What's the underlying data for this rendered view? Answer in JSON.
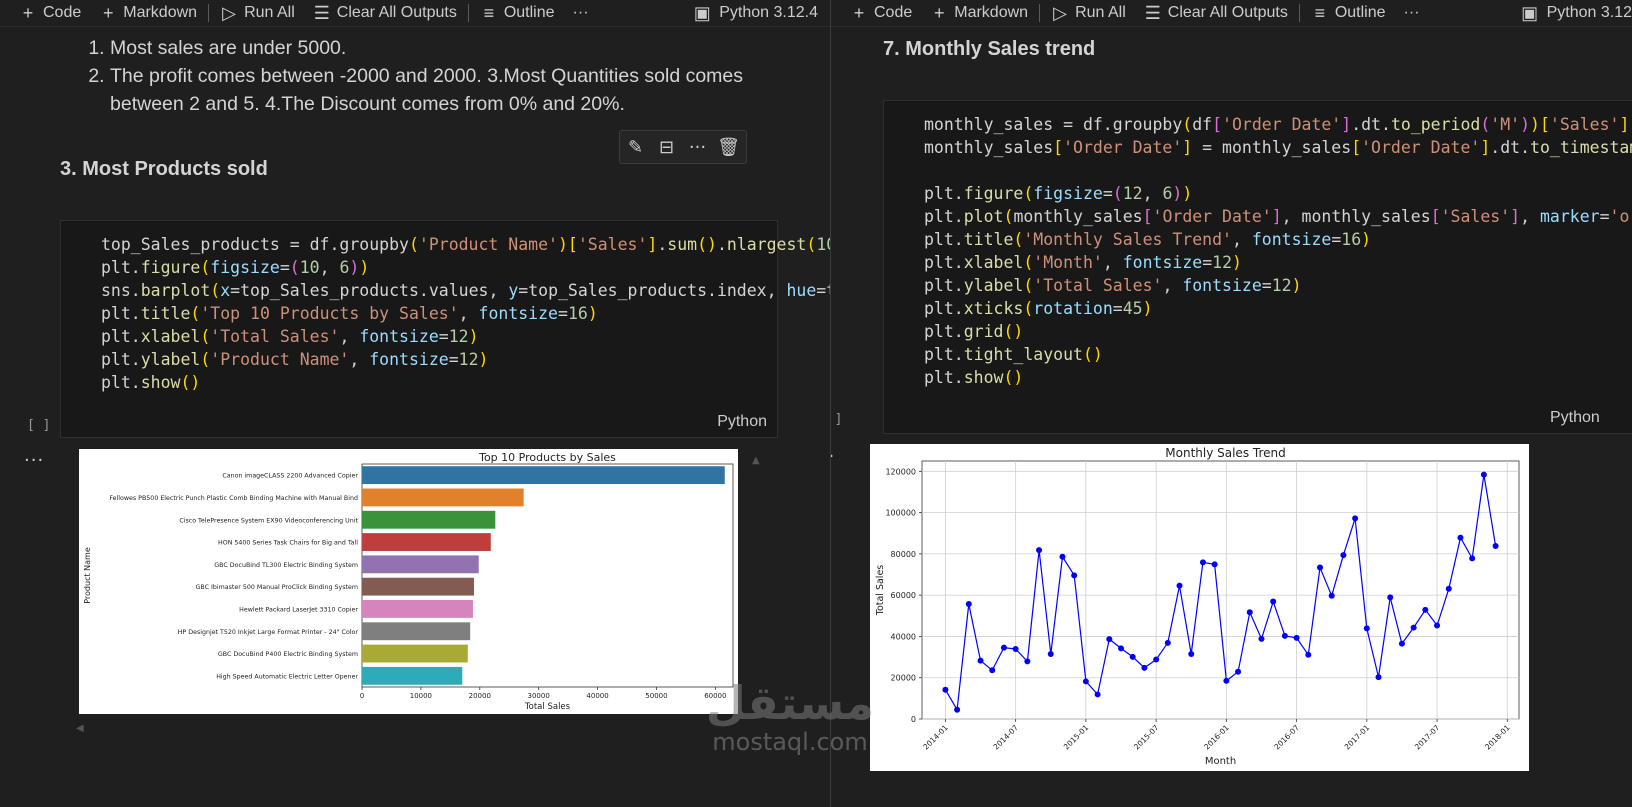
{
  "toolbar": {
    "code": "Code",
    "markdown": "Markdown",
    "run_all": "Run All",
    "clear_all_outputs": "Clear All Outputs",
    "outline": "Outline",
    "more": "···",
    "kernel": "Python 3.12.4",
    "kernel_right": "Python 3.12"
  },
  "left": {
    "markdown_list": [
      "Most sales are under 5000.",
      "The profit comes between -2000 and 2000. 3.Most Quantities sold comes between 2 and 5. 4.The Discount comes from 0% and 20%."
    ],
    "heading": "3. Most Products sold",
    "cell_language": "Python",
    "exec_count": "[ ]",
    "output_more": "···"
  },
  "right": {
    "heading": "7. Monthly Sales trend",
    "cell_language": "Python",
    "exec_count": "[ ]",
    "output_more": "···"
  },
  "icons": {
    "add": "plus-icon",
    "run": "run-all-icon",
    "clear": "clear-outputs-icon",
    "outline": "outline-icon",
    "kernel": "kernel-icon",
    "edit": "pencil-icon",
    "split": "split-cell-icon",
    "delete": "trash-icon"
  },
  "watermark": {
    "arabic": "مستقل",
    "latin": "mostaql.com"
  },
  "chart_data": [
    {
      "type": "bar",
      "orientation": "horizontal",
      "title": "Top 10 Products by Sales",
      "xlabel": "Total Sales",
      "ylabel": "Product Name",
      "xlim": [
        0,
        63000
      ],
      "xticks": [
        0,
        10000,
        20000,
        30000,
        40000,
        50000,
        60000
      ],
      "categories": [
        "Canon imageCLASS 2200 Advanced Copier",
        "Fellowes PB500 Electric Punch Plastic Comb Binding Machine with Manual Bind",
        "Cisco TelePresence System EX90 Videoconferencing Unit",
        "HON 5400 Series Task Chairs for Big and Tall",
        "GBC DocuBind TL300 Electric Binding System",
        "GBC Ibimaster 500 Manual ProClick Binding System",
        "Hewlett Packard LaserJet 3310 Copier",
        "HP Designjet T520 Inkjet Large Format Printer - 24\" Color",
        "GBC DocuBind P400 Electric Binding System",
        "High Speed Automatic Electric Letter Opener"
      ],
      "values": [
        61600,
        27450,
        22640,
        21870,
        19820,
        19020,
        18840,
        18370,
        17970,
        17030
      ],
      "colors": [
        "#3274a1",
        "#e1812c",
        "#3a923a",
        "#c03d3e",
        "#9372b2",
        "#845b53",
        "#d684bd",
        "#7f7f7f",
        "#a9aa35",
        "#2eabb8"
      ],
      "grid": false
    },
    {
      "type": "line",
      "title": "Monthly Sales Trend",
      "xlabel": "Month",
      "ylabel": "Total Sales",
      "ylim": [
        0,
        125000
      ],
      "yticks": [
        0,
        20000,
        40000,
        60000,
        80000,
        100000,
        120000
      ],
      "xticks": [
        "2014-01",
        "2014-07",
        "2015-01",
        "2015-07",
        "2016-01",
        "2016-07",
        "2017-01",
        "2017-07",
        "2018-01"
      ],
      "x": [
        "2014-01",
        "2014-02",
        "2014-03",
        "2014-04",
        "2014-05",
        "2014-06",
        "2014-07",
        "2014-08",
        "2014-09",
        "2014-10",
        "2014-11",
        "2014-12",
        "2015-01",
        "2015-02",
        "2015-03",
        "2015-04",
        "2015-05",
        "2015-06",
        "2015-07",
        "2015-08",
        "2015-09",
        "2015-10",
        "2015-11",
        "2015-12",
        "2016-01",
        "2016-02",
        "2016-03",
        "2016-04",
        "2016-05",
        "2016-06",
        "2016-07",
        "2016-08",
        "2016-09",
        "2016-10",
        "2016-11",
        "2016-12",
        "2017-01",
        "2017-02",
        "2017-03",
        "2017-04",
        "2017-05",
        "2017-06",
        "2017-07",
        "2017-08",
        "2017-09",
        "2017-10",
        "2017-11",
        "2017-12"
      ],
      "values": [
        14200,
        4500,
        55700,
        28300,
        23600,
        34600,
        33900,
        27900,
        81800,
        31500,
        78600,
        69600,
        18200,
        11900,
        38700,
        34200,
        30100,
        24800,
        28800,
        36900,
        64600,
        31500,
        75900,
        74900,
        18500,
        22900,
        51700,
        38800,
        56900,
        40300,
        39300,
        31100,
        73400,
        59700,
        79400,
        97200,
        43900,
        20300,
        58900,
        36500,
        44300,
        52900,
        45300,
        63100,
        87900,
        77800,
        118400,
        83800
      ],
      "color": "#0000ff",
      "marker": "o",
      "grid": true
    }
  ]
}
